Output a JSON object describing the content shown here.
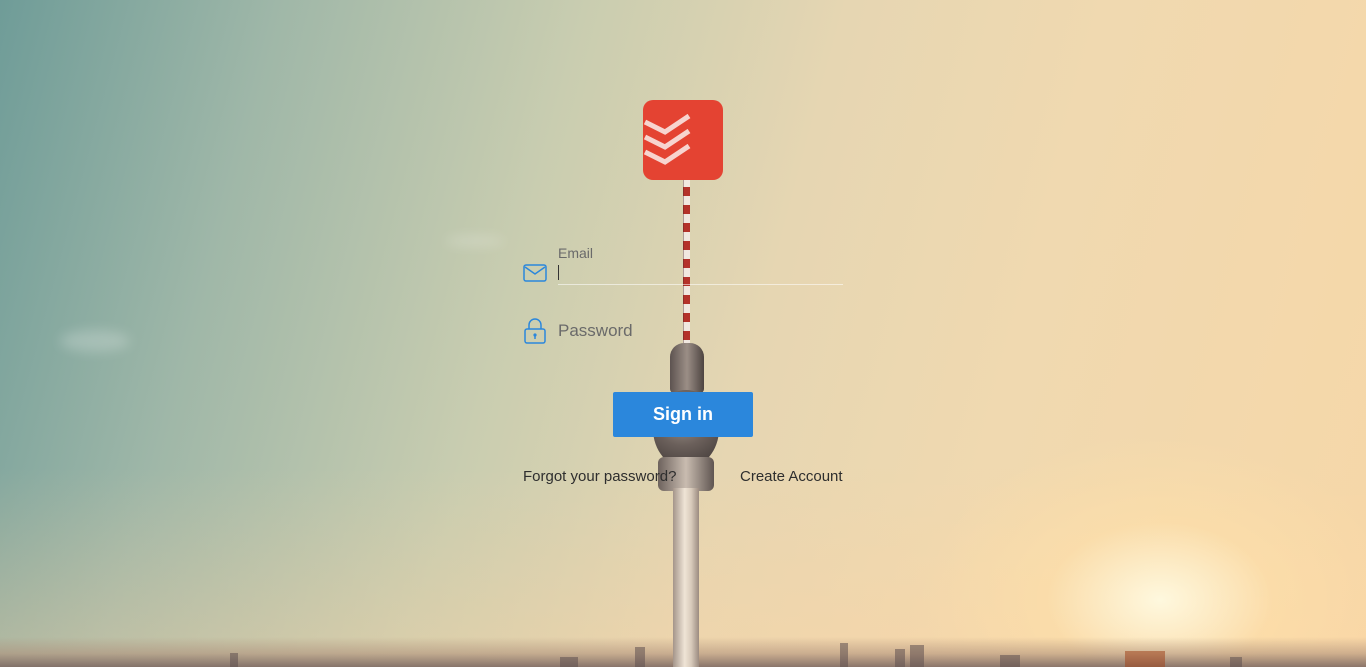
{
  "login": {
    "logo_icon": "todoist-logo-icon",
    "email": {
      "label": "Email",
      "value": "",
      "icon": "envelope-icon"
    },
    "password": {
      "label": "Password",
      "value": "",
      "icon": "lock-icon"
    },
    "sign_in_label": "Sign in",
    "forgot_password_label": "Forgot your password?",
    "create_account_label": "Create Account"
  },
  "colors": {
    "brand_red": "#e44332",
    "button_blue": "#2b87dc",
    "icon_blue": "#2b87dc"
  }
}
